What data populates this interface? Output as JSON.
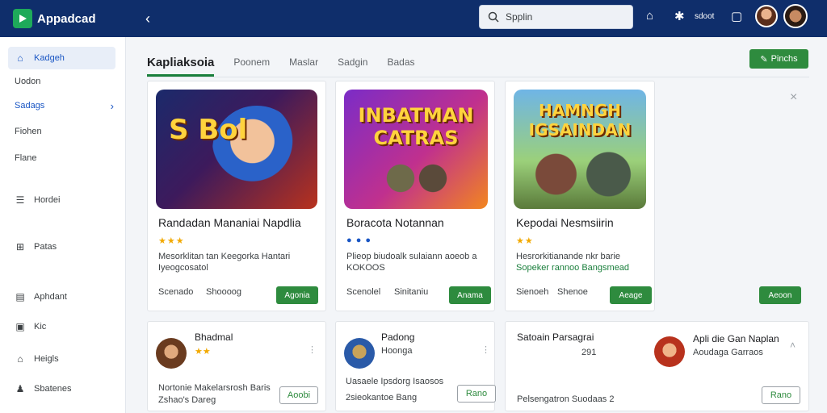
{
  "app": {
    "name": "Appadcad",
    "accent": "#2e8b3e",
    "topbar_color": "#0f2e6b"
  },
  "topbar": {
    "search_placeholder": "Spplin",
    "user_text": "sdoot",
    "icons": [
      "back-icon",
      "search-icon",
      "bookmark-icon",
      "settings-icon",
      "tablet-icon",
      "avatar",
      "profile-avatar"
    ]
  },
  "sidebar": {
    "items": [
      {
        "label": "Kadgeh",
        "icon": "home-icon"
      },
      {
        "label": "Uodon"
      },
      {
        "label": "Sadags"
      },
      {
        "label": "Fiohen"
      },
      {
        "label": "Flane"
      },
      {
        "label": "Hordei",
        "icon": "list-icon"
      },
      {
        "label": "Patas",
        "icon": "grid-icon"
      },
      {
        "label": "Aphdant",
        "icon": "clipboard-icon"
      },
      {
        "label": "Kic",
        "icon": "document-icon"
      },
      {
        "label": "Heigls",
        "icon": "house-icon"
      },
      {
        "label": "Sbatenes",
        "icon": "people-icon"
      }
    ]
  },
  "tabs": [
    "Kapliaksoia",
    "Poonem",
    "Maslar",
    "Sadgin",
    "Badas"
  ],
  "primary_button": "Pinchs",
  "cards": [
    {
      "thumb_text": "S Bol",
      "title": "Randadan Mananiai Napdlia",
      "rating": "★★★",
      "desc_line1": "Mesorklitan tan Keegorka Hantari",
      "desc_line2": "Iyeogcosatol",
      "meta_left": "Scenado",
      "meta_right": "Shoooog",
      "button": "Agonia"
    },
    {
      "thumb_text": "INBATMAN CATRAS",
      "title": "Boracota Notannan",
      "rating": "● ● ●",
      "desc_line1": "Plieop biudoalk sulaiann aoeob a",
      "desc_line2": "KOKOOS",
      "meta_left": "Scenolel",
      "meta_right": "Sinitaniu",
      "button": "Anama"
    },
    {
      "thumb_text": "HAMNGH IGSAINDAN",
      "title": "Kepodai Nesmsiirin",
      "rating": "★★",
      "desc_line1": "Hesrorkitianande nkr barie",
      "desc_line2": "Sopeker rannoo Bangsmead",
      "meta_left": "Sienoeh",
      "meta_right": "Shenoe",
      "button": "Aeage"
    }
  ],
  "extra_button": "Aeoon",
  "mini_cards": [
    {
      "title": "Bhadmal",
      "rating": "★★",
      "line1": "Nortonie Makelarsrosh Baris",
      "line2": "Zshao's Dareg",
      "button": "Aoobi"
    },
    {
      "title": "Padong",
      "rating": "Hoonga",
      "line1": "Uasaele Ipsdorg Isaosos",
      "line2": "2sieokantoe Bang",
      "button": "Rano"
    },
    {
      "title": "Satoain Parsagrai",
      "line1": "291",
      "line2": "Pelsengatron Suodaas 2",
      "right_title": "Apli die Gan Naplan",
      "right_line": "Aoudaga Garraos",
      "button": "Rano"
    }
  ]
}
